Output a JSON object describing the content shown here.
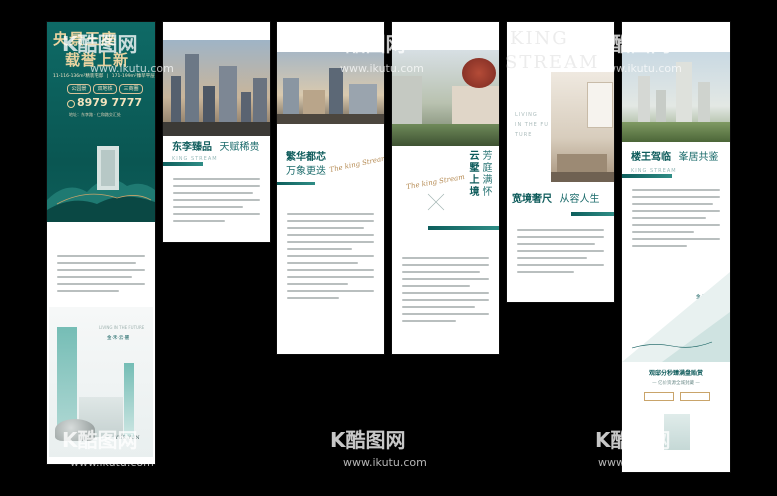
{
  "panel1": {
    "headline_1": "央景王座",
    "headline_2": "载誉上新",
    "spec_1": "11-116-136m²精装宅邸",
    "spec_2": "171-199m²臻萃平层",
    "tags": [
      "公园景",
      "双地铁",
      "三商圈"
    ],
    "phone": "8979 7777",
    "address": "地址：东李路 · 仁和路交汇处",
    "card_text": "LIVING IN THE FUTURE",
    "card_name": "金·禾·云·麓",
    "logo": "YUE YUN"
  },
  "panel2": {
    "title_main": "东李臻品",
    "title_sub": "天赋稀贵",
    "sub_en": "KING STREAM"
  },
  "panel3": {
    "title_main": "繁华都芯",
    "title_sub": "万象更迭",
    "script": "The king Stream"
  },
  "panel4": {
    "vertical_1": "云墅上境",
    "vertical_2": "芳庭满怀",
    "script": "The king Stream"
  },
  "panel5": {
    "en_1": "LIVING",
    "en_2": "IN THE FU",
    "en_3": "TURE",
    "title_main": "宽境奢尺",
    "title_sub": "从容人生"
  },
  "panel6": {
    "title_main": "楼王驾临",
    "title_sub": "峯居共鉴",
    "sub_en": "KING STREAM",
    "small_name": "金·禾·云·麓",
    "cta_1": "观邸分秒臻满盘贻赏",
    "cta_2": "— 亿价资源全城封藏 —"
  },
  "ghost_text": {
    "top": "KING",
    "top2": "STREAM"
  },
  "watermarks": {
    "logo": "酷图网",
    "url": "www.ikutu.com"
  },
  "colors": {
    "teal_dark": "#0d5e5c",
    "teal_mid": "#2f8d86",
    "gold": "#c9a46a",
    "background": "#000000"
  }
}
